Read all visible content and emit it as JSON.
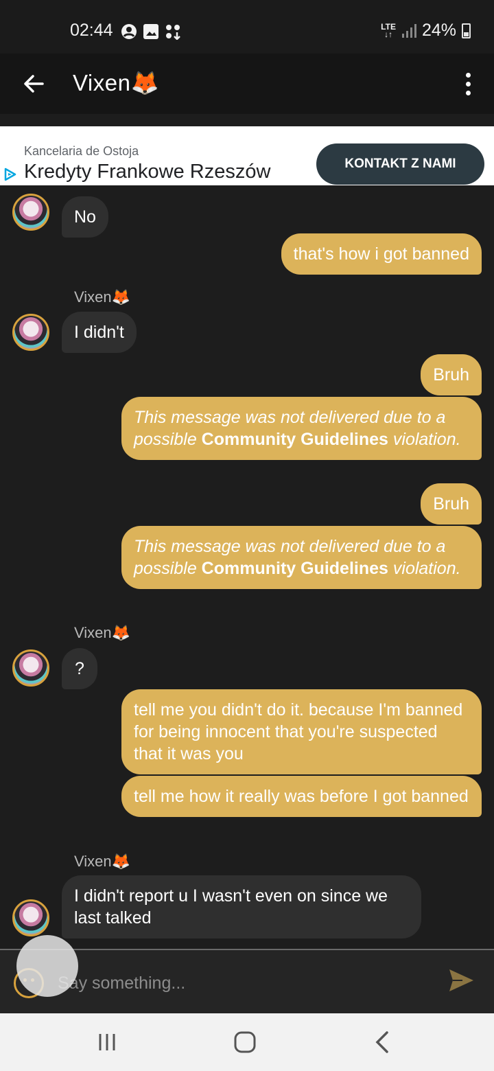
{
  "status_bar": {
    "time": "02:44",
    "network": "LTE",
    "battery": "24%"
  },
  "header": {
    "title": "Vixen🦊"
  },
  "ad": {
    "advertiser": "Kancelaria de Ostoja",
    "headline": "Kredyty Frankowe Rzeszów",
    "cta": "KONTAKT Z NAMI"
  },
  "messages": [
    {
      "dir": "in",
      "text": "No"
    },
    {
      "dir": "out",
      "text": "that's how i got banned"
    },
    {
      "dir": "in",
      "sender": "Vixen🦊",
      "text": "I didn't"
    },
    {
      "dir": "out",
      "text": "Bruh"
    },
    {
      "dir": "out",
      "blocked": true,
      "text_before": "This message was not delivered due to a possible ",
      "link": "Community Guidelines",
      "text_after": " violation."
    },
    {
      "dir": "out",
      "text": "Bruh"
    },
    {
      "dir": "out",
      "blocked": true,
      "text_before": "This message was not delivered due to a possible ",
      "link": "Community Guidelines",
      "text_after": " violation."
    },
    {
      "dir": "in",
      "sender": "Vixen🦊",
      "text": "?"
    },
    {
      "dir": "out",
      "text": "tell me you didn't do it. because I'm banned for being innocent that you're suspected that it was you"
    },
    {
      "dir": "out",
      "text": "tell me how it really was before I got banned"
    },
    {
      "dir": "in",
      "sender": "Vixen🦊",
      "text": "I didn't report u I wasn't even on since we last talked"
    }
  ],
  "input": {
    "placeholder": "Say something..."
  },
  "colors": {
    "accent": "#dcb35a",
    "incoming_bubble": "#2f2f2f",
    "background": "#1d1d1d"
  }
}
